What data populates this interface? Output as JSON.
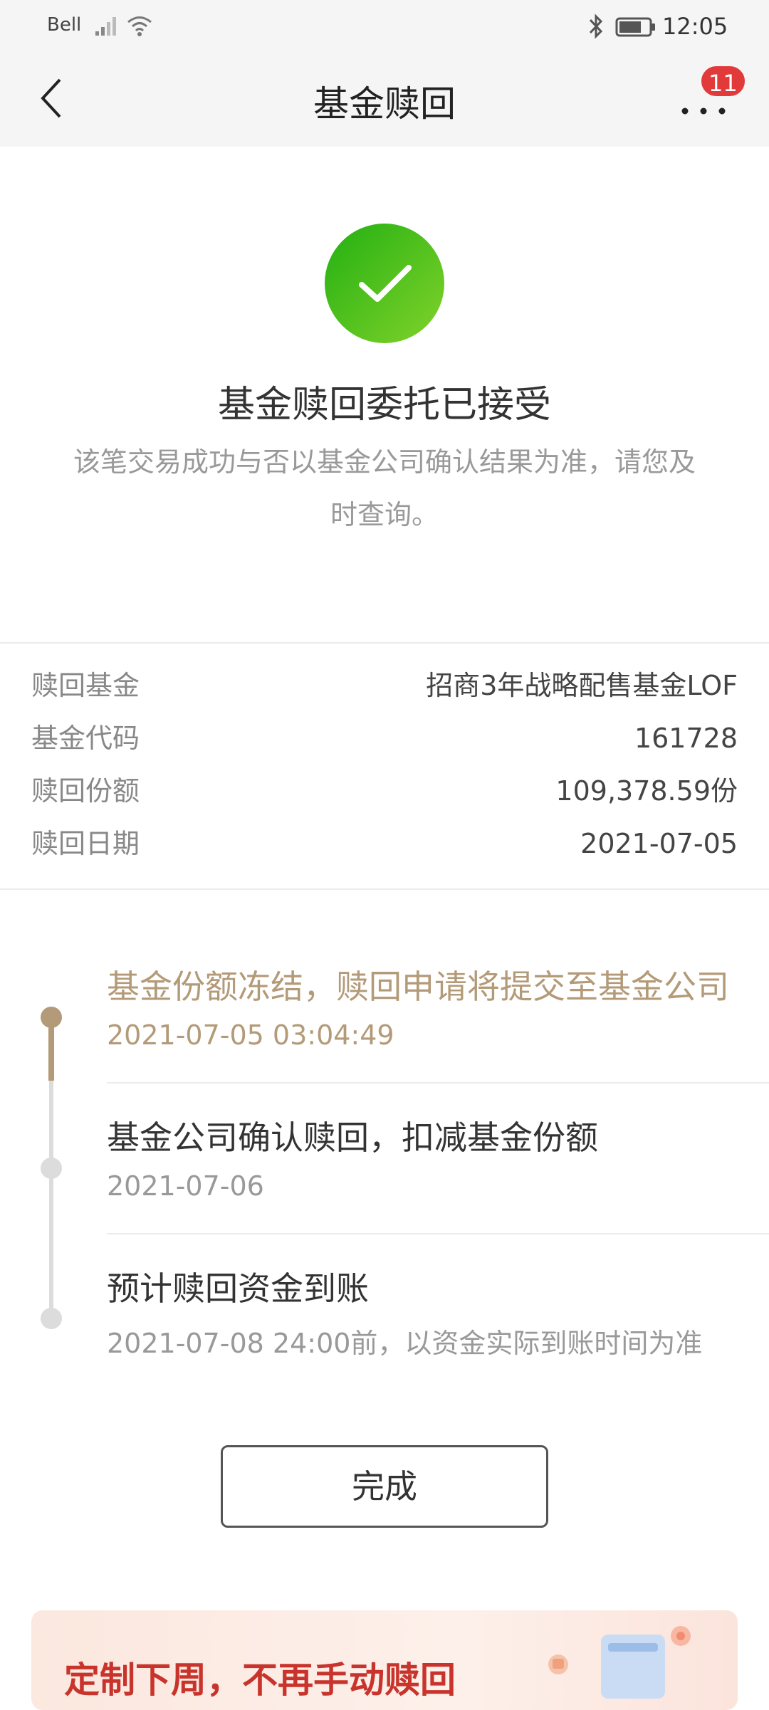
{
  "status_bar": {
    "carrier": "Bell",
    "time": "12:05",
    "icons": [
      "signal-icon",
      "wifi-icon",
      "bluetooth-icon",
      "battery-icon"
    ]
  },
  "header": {
    "title": "基金赎回",
    "back_icon": "chevron-left-icon",
    "more_icon": "more-dots-icon",
    "notification_count": "11"
  },
  "result": {
    "icon": "check-circle-icon",
    "title": "基金赎回委托已接受",
    "description": "该笔交易成功与否以基金公司确认结果为准，请您及时查询。"
  },
  "details": [
    {
      "label": "赎回基金",
      "value": "招商3年战略配售基金LOF"
    },
    {
      "label": "基金代码",
      "value": "161728"
    },
    {
      "label": "赎回份额",
      "value": "109,378.59份"
    },
    {
      "label": "赎回日期",
      "value": "2021-07-05"
    }
  ],
  "timeline": [
    {
      "title": "基金份额冻结，赎回申请将提交至基金公司",
      "sub": "2021-07-05   03:04:49",
      "status": "done"
    },
    {
      "title": "基金公司确认赎回，扣减基金份额",
      "sub": "2021-07-06",
      "status": "pending"
    },
    {
      "title": "预计赎回资金到账",
      "sub": "2021-07-08 24:00前，以资金实际到账时间为准",
      "status": "pending"
    }
  ],
  "finish_button": {
    "label": "完成"
  },
  "banner": {
    "text": "定制下周，不再手动赎回"
  },
  "colors": {
    "success_green": "#3cb815",
    "timeline_done": "#b39a78",
    "badge_red": "#e23a3a",
    "banner_red": "#c8342c"
  }
}
